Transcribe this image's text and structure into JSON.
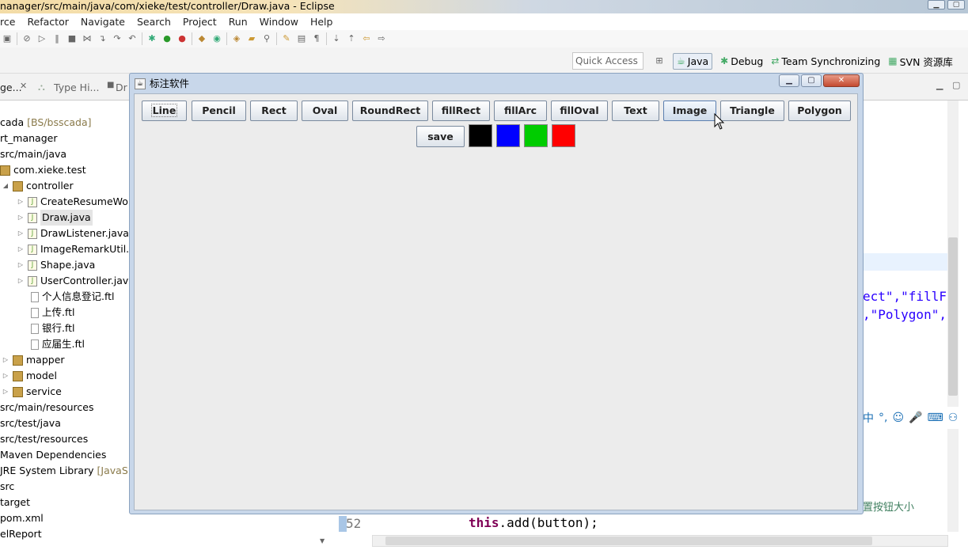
{
  "eclipse": {
    "title": "nanager/src/main/java/com/xieke/test/controller/Draw.java - Eclipse",
    "menu": [
      "rce",
      "Refactor",
      "Navigate",
      "Search",
      "Project",
      "Run",
      "Window",
      "Help"
    ],
    "quick_access": "Quick Access",
    "perspectives": [
      "Java",
      "Debug",
      "Team Synchronizing",
      "SVN 资源库"
    ],
    "left_tabs": [
      "ge...",
      "Type Hi...",
      "Dr"
    ],
    "tree": [
      {
        "label": "cada",
        "suffix": " [BS/bsscada]"
      },
      {
        "label": "rt_manager"
      },
      {
        "label": "src/main/java"
      },
      {
        "label": "com.xieke.test"
      },
      {
        "label": "controller"
      },
      {
        "label": "CreateResumeWo"
      },
      {
        "label": "Draw.java"
      },
      {
        "label": "DrawListener.java"
      },
      {
        "label": "ImageRemarkUtil."
      },
      {
        "label": "Shape.java"
      },
      {
        "label": "UserController.jav"
      },
      {
        "label": "个人信息登记.ftl"
      },
      {
        "label": "上传.ftl"
      },
      {
        "label": "银行.ftl"
      },
      {
        "label": "应届生.ftl"
      },
      {
        "label": "mapper"
      },
      {
        "label": "model"
      },
      {
        "label": "service"
      },
      {
        "label": "src/main/resources"
      },
      {
        "label": "src/test/java"
      },
      {
        "label": "src/test/resources"
      },
      {
        "label": "Maven Dependencies"
      },
      {
        "label": "JRE System Library",
        "suffix": " [JavaSE-"
      },
      {
        "label": "src"
      },
      {
        "label": "target"
      },
      {
        "label": "pom.xml"
      },
      {
        "label": "elReport"
      }
    ],
    "code_line1": "ect\",\"fillF",
    "code_line2": ",\"Polygon\",",
    "line_number": "52",
    "code_keyword": "this",
    "code_rest": ".add(button);",
    "comment_fragment": "置按钮大小",
    "ime": {
      "zh": "中",
      "punct": "°,"
    }
  },
  "swing": {
    "title": "标注软件",
    "tools": [
      "Line",
      "Pencil",
      "Rect",
      "Oval",
      "RoundRect",
      "fillRect",
      "fillArc",
      "fillOval",
      "Text",
      "Image",
      "Triangle",
      "Polygon"
    ],
    "save": "save",
    "colors": [
      "#000000",
      "#0000ff",
      "#00cc00",
      "#ff0000"
    ]
  }
}
